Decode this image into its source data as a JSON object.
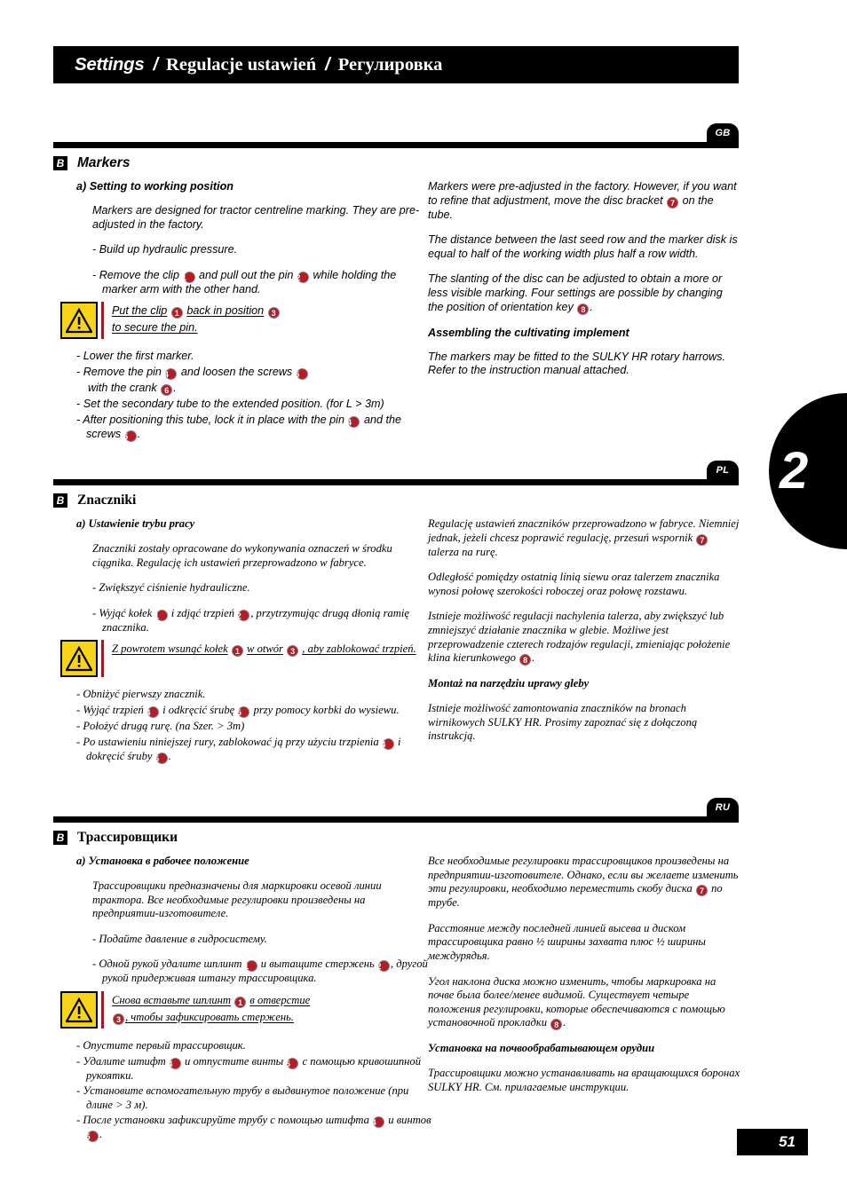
{
  "header": {
    "title_en": "Settings",
    "separator": "/",
    "title_pl": "Regulacje ustawień",
    "title_ru": "Регулировка"
  },
  "chapter_tab": "2",
  "page_number": "51",
  "colors": {
    "accent_red": "#b81c22",
    "warning_yellow": "#f7d417",
    "bar_black": "#000000"
  },
  "sections": [
    {
      "lang_badge": "GB",
      "letter": "B",
      "title": "Markers",
      "left": {
        "subhead": "a) Setting to working position",
        "intro": "Markers are designed for tractor centreline marking. They are pre-adjusted in the factory.",
        "bullet1": "- Build up hydraulic pressure.",
        "bullet2_a": "-  Remove the clip",
        "bullet2_n1": "1",
        "bullet2_b": "and pull out the pin",
        "bullet2_n2": "2",
        "bullet2_c": "while holding the marker arm with the other hand.",
        "warning_a": "Put the clip",
        "warning_n1": "1",
        "warning_b": "back in position",
        "warning_n2": "3",
        "warning_c": "to secure the pin.",
        "b3": "- Lower the first marker.",
        "b4_a": "- Remove the pin",
        "b4_n1": "4",
        "b4_b": "and loosen the screws",
        "b4_n2": "5",
        "b5_a": "with the crank",
        "b5_n1": "6",
        "b5_b": ".",
        "b6": "- Set the secondary tube to the extended position. (for L > 3m)",
        "b7_a": "- After positioning this tube, lock it in place with the pin",
        "b7_n1": "4",
        "b7_b": "and the screws",
        "b7_n2": "5",
        "b7_c": "."
      },
      "right": {
        "p1_a": "Markers were pre-adjusted in the factory. However, if you want to refine that adjustment, move the disc bracket",
        "p1_n": "7",
        "p1_b": "on the tube.",
        "p2": "The distance between the last seed row and the marker disk is equal to half of the working width plus half a row width.",
        "p3_a": "The slanting of the disc can be adjusted to obtain a more or less visible marking. Four settings are possible by changing the position of orientation key",
        "p3_n": "8",
        "p3_b": ".",
        "head2": "Assembling the cultivating implement",
        "p4": "The markers may be fitted to the SULKY HR rotary harrows. Refer to the instruction manual attached."
      }
    },
    {
      "lang_badge": "PL",
      "letter": "B",
      "title": "Znaczniki",
      "left": {
        "subhead": "a) Ustawienie trybu pracy",
        "intro": "Znaczniki zostały opracowane do wykonywania oznaczeń w środku ciągnika. Regulację ich ustawień przeprowadzono w fabryce.",
        "bullet1": "- Zwiększyć ciśnienie hydrauliczne.",
        "bullet2_a": "- Wyjąć kołek",
        "bullet2_n1": "1",
        "bullet2_b": "i zdjąć trzpień",
        "bullet2_n2": "2",
        "bullet2_c": ", przytrzymując drugą dłonią ramię znacznika.",
        "warning_a": "Z powrotem wsunąć kołek",
        "warning_n1": "1",
        "warning_b": "w otwór",
        "warning_n2": "3",
        "warning_c": ", aby zablokować trzpień.",
        "b3": "- Obniżyć pierwszy znacznik.",
        "b4_a": "- Wyjąć trzpień",
        "b4_n1": "4",
        "b4_b": "i odkręcić śrubę",
        "b4_n2": "5",
        "b4_c": "przy pomocy korbki do wysiewu.",
        "b6": "- Położyć drugą rurę. (na Szer. > 3m)",
        "b7_a": "- Po ustawieniu niniejszej rury, zablokować ją przy użyciu trzpienia",
        "b7_n1": "4",
        "b7_b": "i dokręcić śruby",
        "b7_n2": "5",
        "b7_c": "."
      },
      "right": {
        "p1_a": "Regulację ustawień znaczników przeprowadzono w fabryce. Niemniej jednak, jeżeli chcesz poprawić regulację, przesuń wspornik",
        "p1_n": "7",
        "p1_b": "talerza na rurę.",
        "p2": "Odległość pomiędzy ostatnią linią siewu oraz talerzem znacznika wynosi połowę szerokości roboczej oraz połowę rozstawu.",
        "p3_a": "Istnieje możliwość regulacji nachylenia talerza, aby zwiększyć lub zmniejszyć działanie znacznika w glebie. Możliwe jest przeprowadzenie czterech rodzajów regulacji, zmieniając położenie klina kierunkowego",
        "p3_n": "8",
        "p3_b": ".",
        "head2": "Montaż na narzędziu uprawy gleby",
        "p4": "Istnieje możliwość zamontowania znaczników na bronach wirnikowych SULKY HR. Prosimy zapoznać się z dołączoną instrukcją."
      }
    },
    {
      "lang_badge": "RU",
      "letter": "B",
      "title": "Трассировщики",
      "left": {
        "subhead": "a) Установка в рабочее положение",
        "intro": "Трассировщики предназначены для маркировки осевой линии трактора. Все необходимые регулировки произведены на предприятии-изготовителе.",
        "bullet1": "- Подайте давление в гидросистему.",
        "bullet2_a": "- Одной рукой удалите шплинт",
        "bullet2_n1": "1",
        "bullet2_b": "и вытащите стержень",
        "bullet2_n2": "2",
        "bullet2_c": ", другой рукой придерживая штангу трассировщика.",
        "warning_a": "Снова вставьте шплинт",
        "warning_n1": "1",
        "warning_b": "в отверстие",
        "warning_n2": "3",
        "warning_c": ", чтобы зафиксировать стержень.",
        "b3": "- Опустите первый трассировщик.",
        "b4_a": "- Удалите штифт",
        "b4_n1": "4",
        "b4_b": "и отпустите винты",
        "b4_n2": "5",
        "b4_c": "с помощью кривошипной рукоятки.",
        "b6": "- Установите вспомогательную трубу в выдвинутое положение (при длине > 3 м).",
        "b7_a": "- После установки зафиксируйте трубу с помощью штифта",
        "b7_n1": "4",
        "b7_b": "и винтов",
        "b7_n2": "5",
        "b7_c": "."
      },
      "right": {
        "p1_a": "Все необходимые регулировки трассировщиков произведены на предприятии-изготовителе. Однако, если вы желаете изменить эти регулировки, необходимо переместить скобу диска",
        "p1_n": "7",
        "p1_b": "по трубе.",
        "p2": "Расстояние между последней линией высева и диском трассировщика равно ½ ширины захвата плюс ½ ширины междурядья.",
        "p3_a": "Угол наклона диска можно изменить, чтобы маркировка на почве была более/менее видимой. Существует четыре положения регулировки, которые обеспечиваются с помощью установочной прокладки",
        "p3_n": "8",
        "p3_b": ".",
        "head2": "Установка на почвообрабатывающем орудии",
        "p4": "Трассировщики можно устанавливать на вращающихся боронах SULKY HR. См. прилагаемые инструкции."
      }
    }
  ]
}
